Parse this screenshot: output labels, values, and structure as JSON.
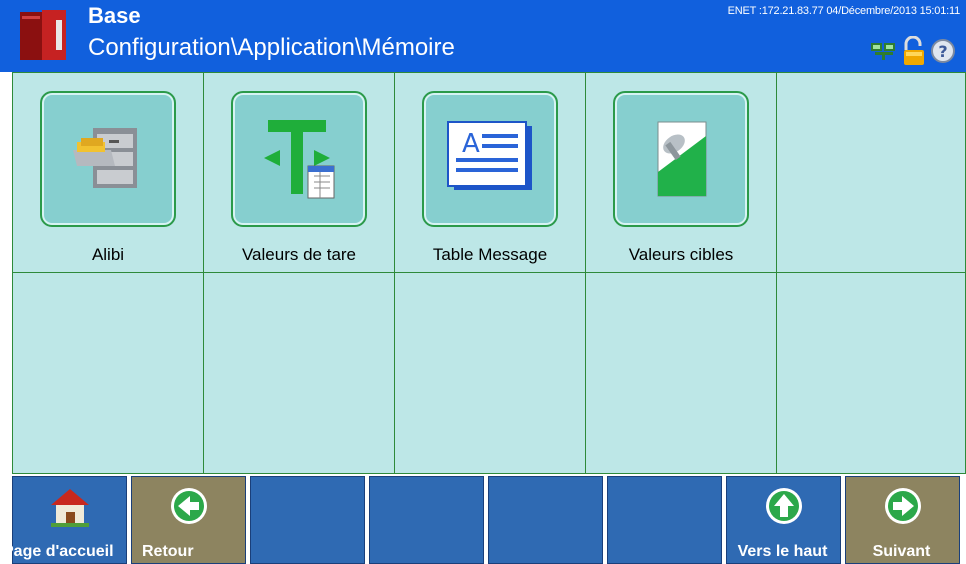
{
  "header": {
    "title": "Base",
    "path": "Configuration\\Application\\Mémoire",
    "status": "ENET :172.21.83.77  04/Décembre/2013 15:01:11"
  },
  "tiles": [
    {
      "label": "Alibi",
      "icon": "file-cabinet-icon"
    },
    {
      "label": "Valeurs de tare",
      "icon": "tare-values-icon"
    },
    {
      "label": "Table Message",
      "icon": "message-table-icon"
    },
    {
      "label": "Valeurs cibles",
      "icon": "target-values-icon"
    }
  ],
  "toolbar": {
    "home_label": "Page d'accueil",
    "back_label": "Retour",
    "up_label": "Vers le haut",
    "next_label": "Suivant"
  },
  "colors": {
    "header": "#1160dd",
    "grid_bg": "#bde7e7",
    "grid_lines": "#2e8a3a",
    "button_blue": "#2f6ab3",
    "button_tan": "#8d8460"
  }
}
